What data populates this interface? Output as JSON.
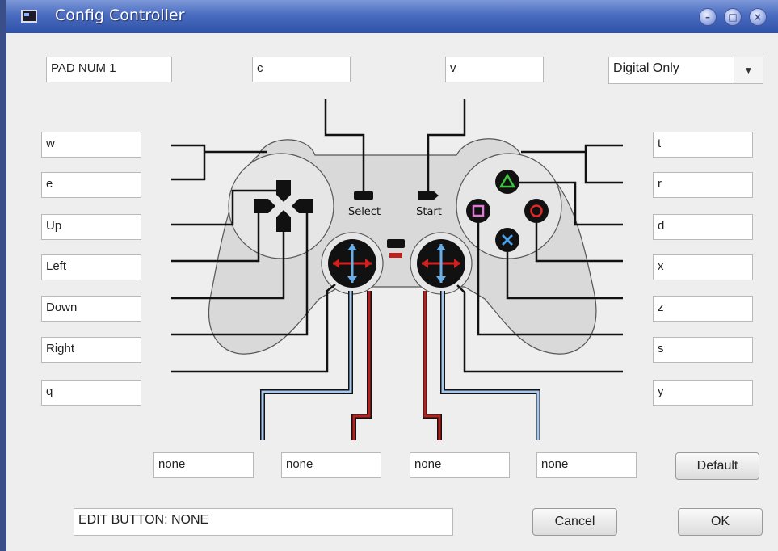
{
  "window": {
    "title": "Config Controller"
  },
  "top_fields": {
    "pad": "PAD NUM 1",
    "select_key": "c",
    "start_key": "v"
  },
  "mode_select": {
    "value": "Digital Only"
  },
  "left_fields": [
    "w",
    "e",
    "Up",
    "Left",
    "Down",
    "Right",
    "q"
  ],
  "right_fields": [
    "t",
    "r",
    "d",
    "x",
    "z",
    "s",
    "y"
  ],
  "analog_fields": [
    "none",
    "none",
    "none",
    "none"
  ],
  "controller": {
    "select_label": "Select",
    "start_label": "Start"
  },
  "status": {
    "value": "EDIT BUTTON: NONE"
  },
  "buttons": {
    "default": "Default",
    "cancel": "Cancel",
    "ok": "OK"
  }
}
